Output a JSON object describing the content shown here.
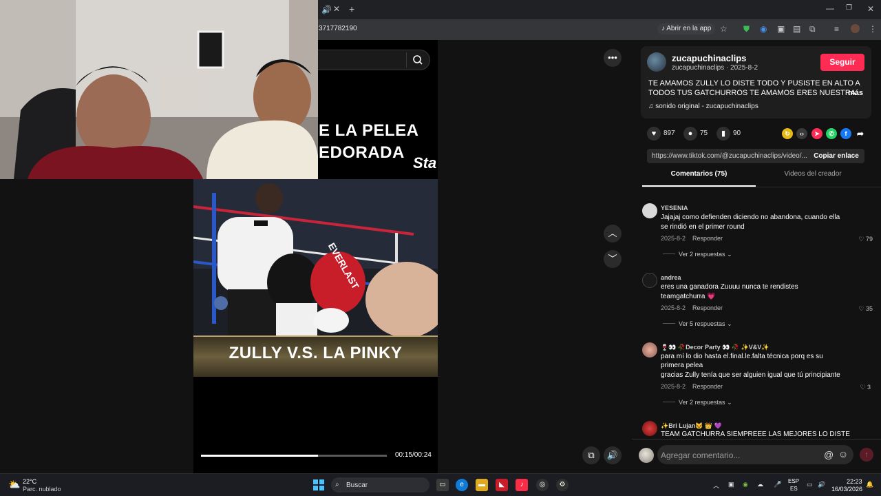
{
  "browser": {
    "url_fragment": "3717782190",
    "open_in_app_label": "Abrir en la app"
  },
  "video": {
    "title_line_1": "E LA PELEA",
    "title_line_2": "EDORADA",
    "title_watermark": "Sta",
    "banner_text": "ZULLY V.S. LA PINKY",
    "glove_text": "EVERLAST",
    "time": "00:15/00:24",
    "progress": 0.63
  },
  "post": {
    "creator_name": "zucapuchinaclips",
    "creator_sub": "zucapuchinaclips · 2025-8-2",
    "follow_label": "Seguir",
    "description_line_1": "TE AMAMOS ZULLY LO DISTE TODO Y PUSISTE EN ALTO A",
    "description_line_2": "TODOS TUS GATCHURROS TE AMAMOS ERES NUESTRA...",
    "more_label": "más",
    "sound": "sonido original - zucapuchinaclips",
    "likes": "897",
    "comments": "75",
    "saves": "90",
    "link_url": "https://www.tiktok.com/@zucapuchinaclips/video/...",
    "copy_link_label": "Copiar enlace"
  },
  "tabs": {
    "comments_label": "Comentarios (75)",
    "videos_label": "Videos del creador"
  },
  "comments": [
    {
      "user": "YESENIA",
      "lines": [
        "Jajajaj como defienden diciendo no abandona, cuando ella",
        "se rindió en el primer round"
      ],
      "date": "2025-8-2",
      "reply": "Responder",
      "likes": "79",
      "view_replies": "Ver 2 respuestas"
    },
    {
      "user": "andrea",
      "lines": [
        "eres una ganadora Zuuuu nunca te rendistes",
        "teamgatchurra 💗"
      ],
      "date": "2025-8-2",
      "reply": "Responder",
      "likes": "35",
      "view_replies": "Ver 5 respuestas"
    },
    {
      "user": "🍷👀 🥀Decor Party 👀 🥀 ✨V&V✨",
      "lines": [
        "para mí lo dio hasta el.final.le.falta técnica porq es su",
        "primera pelea",
        "gracias Zully tenía que ser alguien igual que tú principiante"
      ],
      "date": "2025-8-2",
      "reply": "Responder",
      "likes": "3",
      "view_replies": "Ver 2 respuestas"
    },
    {
      "user": "✨Bri Lujan🐱 👑 💜",
      "lines": [
        "TEAM GATCHURRA SIEMPREEE LAS MEJORES LO DISTE"
      ],
      "date": "",
      "reply": "",
      "likes": "",
      "view_replies": ""
    }
  ],
  "comment_input": {
    "placeholder": "Agregar comentario..."
  },
  "taskbar": {
    "temp": "22°C",
    "weather": "Parc. nublado",
    "search_label": "Buscar",
    "lang_1": "ESP",
    "lang_2": "ES",
    "time": "22:23",
    "date": "16/03/2026"
  },
  "colors": {
    "accent": "#fe2c55",
    "background": "#121212"
  }
}
